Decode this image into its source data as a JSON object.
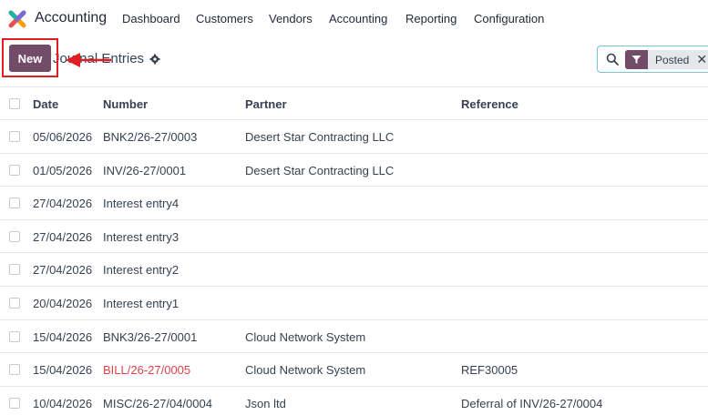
{
  "app": {
    "name": "Accounting"
  },
  "nav": [
    "Dashboard",
    "Customers",
    "Vendors",
    "Accounting",
    "Reporting",
    "Configuration"
  ],
  "controls": {
    "new_label": "New",
    "breadcrumb": "Journal Entries"
  },
  "search": {
    "facet_label": "Posted",
    "close_glyph": "✕"
  },
  "table": {
    "headers": [
      "Date",
      "Number",
      "Partner",
      "Reference"
    ],
    "rows": [
      {
        "date": "05/06/2026",
        "number": "BNK2/26-27/0003",
        "partner": "Desert Star Contracting LLC",
        "reference": "",
        "number_color": ""
      },
      {
        "date": "01/05/2026",
        "number": "INV/26-27/0001",
        "partner": "Desert Star Contracting LLC",
        "reference": "",
        "number_color": ""
      },
      {
        "date": "27/04/2026",
        "number": "Interest entry4",
        "partner": "",
        "reference": "",
        "number_color": ""
      },
      {
        "date": "27/04/2026",
        "number": "Interest entry3",
        "partner": "",
        "reference": "",
        "number_color": ""
      },
      {
        "date": "27/04/2026",
        "number": "Interest entry2",
        "partner": "",
        "reference": "",
        "number_color": ""
      },
      {
        "date": "20/04/2026",
        "number": "Interest entry1",
        "partner": "",
        "reference": "",
        "number_color": ""
      },
      {
        "date": "15/04/2026",
        "number": "BNK3/26-27/0001",
        "partner": "Cloud Network System",
        "reference": "",
        "number_color": ""
      },
      {
        "date": "15/04/2026",
        "number": "BILL/26-27/0005",
        "partner": "Cloud Network System",
        "reference": "REF30005",
        "number_color": "#e0424a"
      },
      {
        "date": "10/04/2026",
        "number": "MISC/26-27/04/0004",
        "partner": "Json ltd",
        "reference": "Deferral of INV/26-27/0004",
        "number_color": ""
      }
    ]
  },
  "colors": {
    "brand": "#714b67",
    "highlight": "#e11d24",
    "search_border": "#76c5d3",
    "overdue_red": "#e0424a"
  }
}
